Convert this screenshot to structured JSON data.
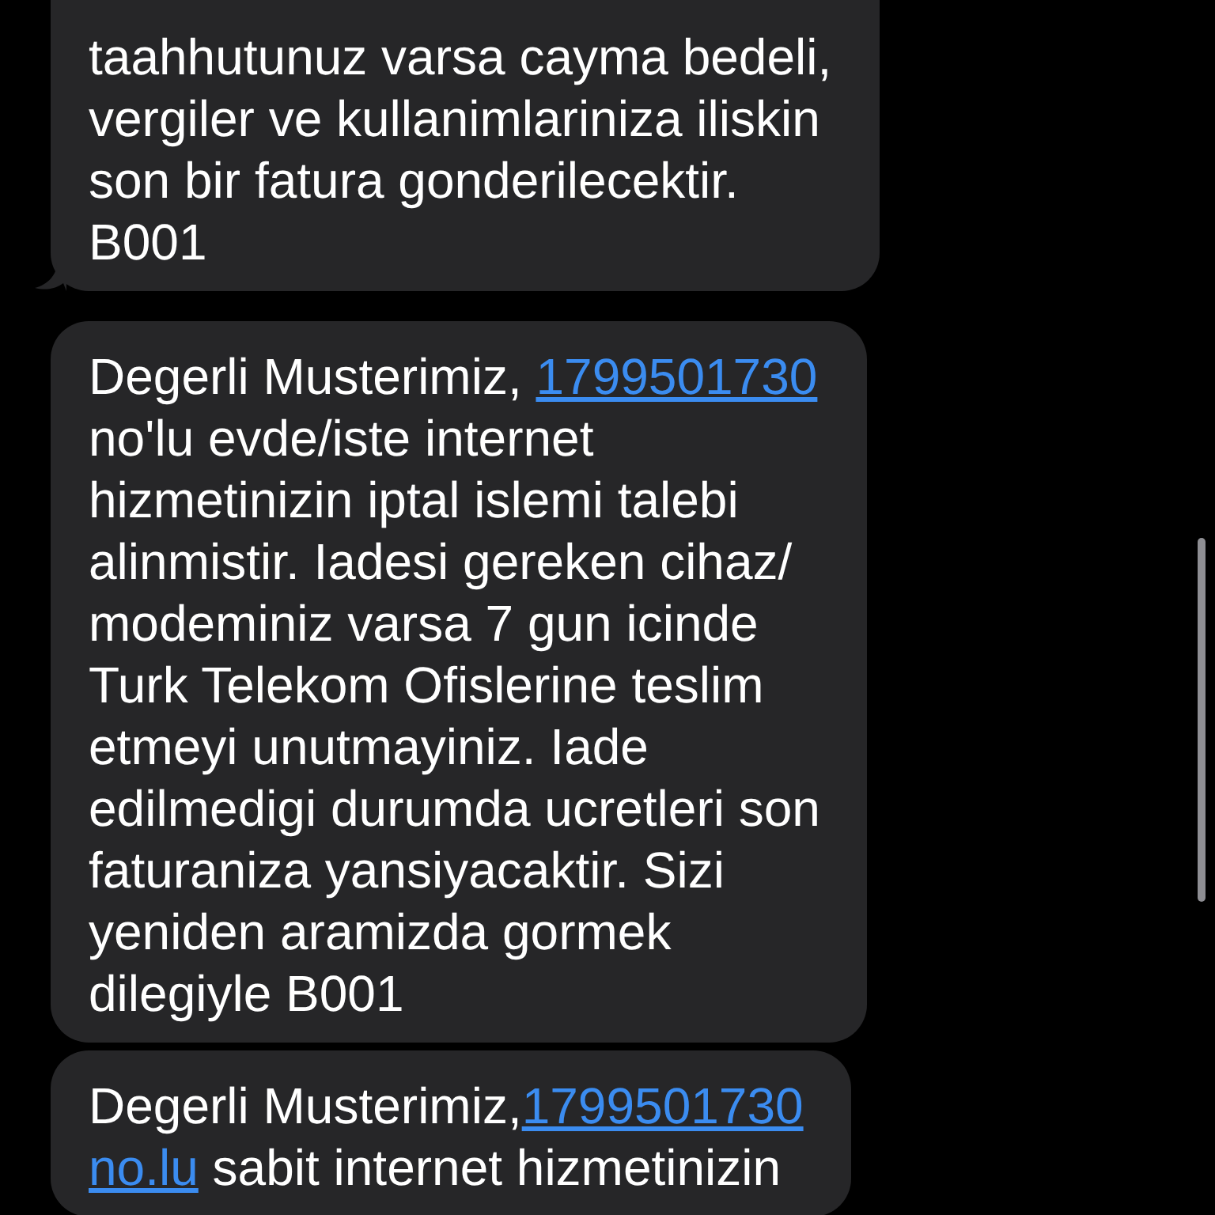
{
  "messages": [
    {
      "tail": true,
      "lines": [
        [
          {
            "kind": "text",
            "text": "taahhutunuz varsa cayma bedeli,"
          }
        ],
        [
          {
            "kind": "text",
            "text": "vergiler ve kullanimlariniza iliskin"
          }
        ],
        [
          {
            "kind": "text",
            "text": "son bir fatura gonderilecektir."
          }
        ],
        [
          {
            "kind": "text",
            "text": "B001"
          }
        ]
      ]
    },
    {
      "tail": false,
      "lines": [
        [
          {
            "kind": "text",
            "text": "Degerli Musterimiz, "
          },
          {
            "kind": "link",
            "text": "1799501730"
          }
        ],
        [
          {
            "kind": "text",
            "text": "no'lu evde/iste internet"
          }
        ],
        [
          {
            "kind": "text",
            "text": "hizmetinizin iptal islemi talebi"
          }
        ],
        [
          {
            "kind": "text",
            "text": "alinmistir. Iadesi gereken cihaz/"
          }
        ],
        [
          {
            "kind": "text",
            "text": "modeminiz varsa 7 gun icinde"
          }
        ],
        [
          {
            "kind": "text",
            "text": "Turk Telekom Ofislerine teslim"
          }
        ],
        [
          {
            "kind": "text",
            "text": "etmeyi unutmayiniz. Iade"
          }
        ],
        [
          {
            "kind": "text",
            "text": "edilmedigi durumda ucretleri son"
          }
        ],
        [
          {
            "kind": "text",
            "text": "faturaniza yansiyacaktir. Sizi"
          }
        ],
        [
          {
            "kind": "text",
            "text": "yeniden aramizda gormek"
          }
        ],
        [
          {
            "kind": "text",
            "text": "dilegiyle B001"
          }
        ]
      ]
    },
    {
      "tail": false,
      "lines": [
        [
          {
            "kind": "text",
            "text": "Degerli Musterimiz,"
          },
          {
            "kind": "link",
            "text": "1799501730"
          }
        ],
        [
          {
            "kind": "link",
            "text": "no.lu"
          },
          {
            "kind": "text",
            "text": " sabit internet hizmetinizin"
          }
        ]
      ]
    }
  ]
}
